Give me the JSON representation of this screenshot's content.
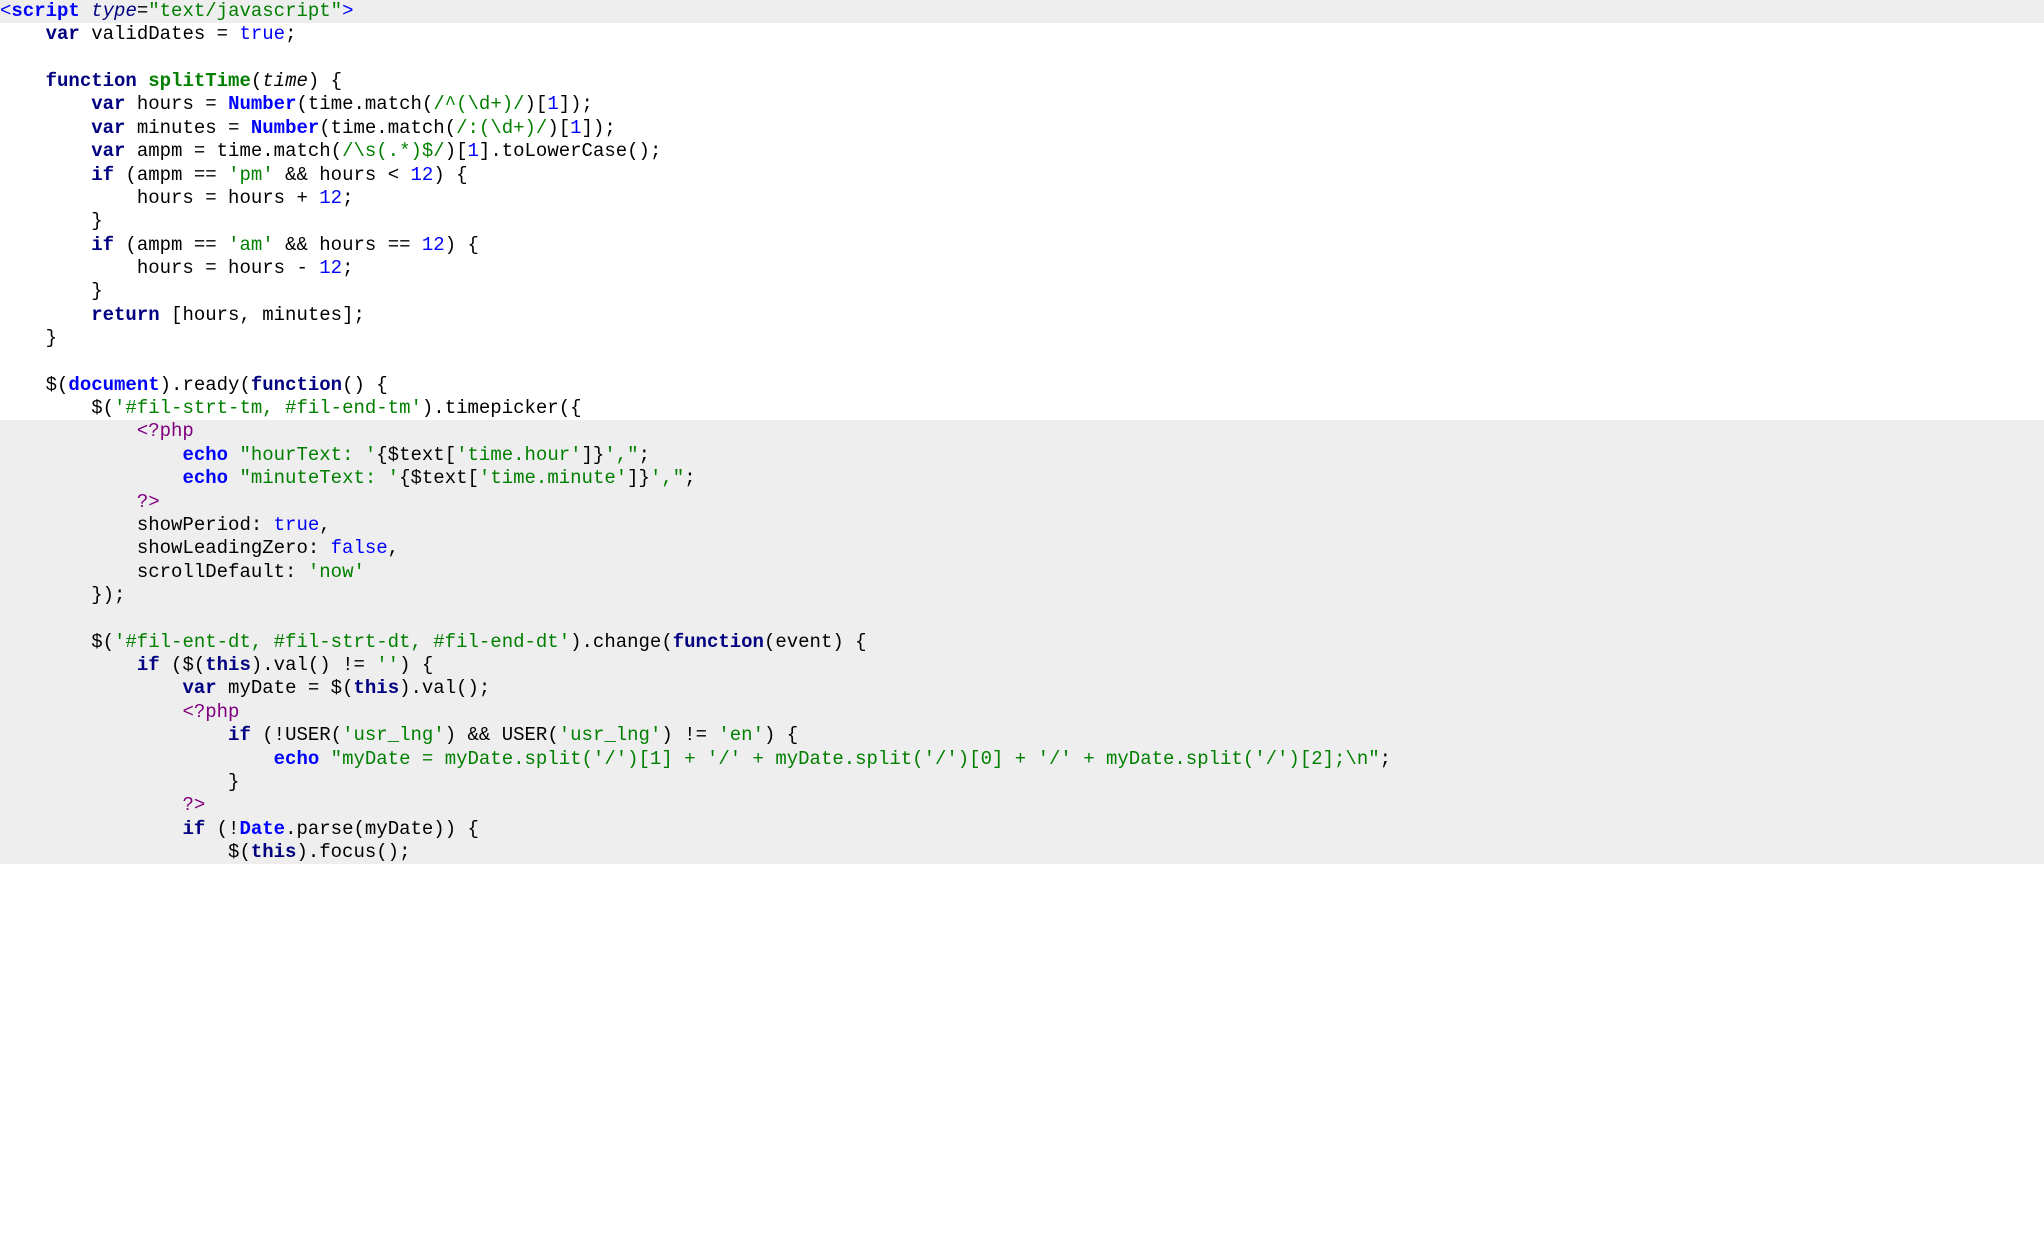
{
  "lines": [
    {
      "hl": true,
      "indent": 0,
      "html": "<span class='tag'>&lt;<b>script</b></span> <span class='attr'>type</span>=<span class='str'>\"text/javascript\"</span><span class='tag'>&gt;</span>"
    },
    {
      "hl": false,
      "indent": 4,
      "html": "<span class='kw'>var</span> validDates = <span class='bool'>true</span>;"
    },
    {
      "hl": false,
      "indent": 0,
      "html": ""
    },
    {
      "hl": false,
      "indent": 4,
      "html": "<span class='kw'>function</span> <span class='fnname'>splitTime</span>(<span class='param'>time</span>)<span class='op'> {</span>"
    },
    {
      "hl": false,
      "indent": 8,
      "html": "<span class='kw'>var</span> hours = <span class='global'>Number</span>(time.match(<span class='regex'>/^(\\d+)/</span>)[<span class='num'>1</span>]);"
    },
    {
      "hl": false,
      "indent": 8,
      "html": "<span class='kw'>var</span> minutes = <span class='global'>Number</span>(time.match(<span class='regex'>/:(\\d+)/</span>)[<span class='num'>1</span>]);"
    },
    {
      "hl": false,
      "indent": 8,
      "html": "<span class='kw'>var</span> ampm = time.match(<span class='regex'>/\\s(.*)$/</span>)[<span class='num'>1</span>].toLowerCase();"
    },
    {
      "hl": false,
      "indent": 8,
      "html": "<span class='kw'>if</span> (ampm == <span class='str'>'pm'</span> &amp;&amp; hours &lt; <span class='num'>12</span>) {"
    },
    {
      "hl": false,
      "indent": 12,
      "html": "hours = hours + <span class='num'>12</span>;"
    },
    {
      "hl": false,
      "indent": 8,
      "html": "}"
    },
    {
      "hl": false,
      "indent": 8,
      "html": "<span class='kw'>if</span> (ampm == <span class='str'>'am'</span> &amp;&amp; hours == <span class='num'>12</span>) {"
    },
    {
      "hl": false,
      "indent": 12,
      "html": "hours = hours - <span class='num'>12</span>;"
    },
    {
      "hl": false,
      "indent": 8,
      "html": "}"
    },
    {
      "hl": false,
      "indent": 8,
      "html": "<span class='kw'>return</span> [hours, minutes];"
    },
    {
      "hl": false,
      "indent": 4,
      "html": "}"
    },
    {
      "hl": false,
      "indent": 0,
      "html": ""
    },
    {
      "hl": false,
      "indent": 4,
      "html": "$(<span class='global'>document</span>).ready(<span class='fn'>function</span>() {"
    },
    {
      "hl": false,
      "indent": 8,
      "html": "$(<span class='str'>'#fil-strt-tm, #fil-end-tm'</span>).timepicker({"
    },
    {
      "hl": true,
      "indent": 12,
      "html": "<span class='phptag'>&lt;?php</span>"
    },
    {
      "hl": true,
      "indent": 16,
      "html": "<span class='phpkw'>echo</span> <span class='phpstr'>\"hourText: '</span>{$text[<span class='phpstr'>'time.hour'</span>]}<span class='phpstr'>',\"</span>;"
    },
    {
      "hl": true,
      "indent": 16,
      "html": "<span class='phpkw'>echo</span> <span class='phpstr'>\"minuteText: '</span>{$text[<span class='phpstr'>'time.minute'</span>]}<span class='phpstr'>',\"</span>;"
    },
    {
      "hl": true,
      "indent": 12,
      "html": "<span class='phptag'>?&gt;</span>"
    },
    {
      "hl": true,
      "indent": 12,
      "html": "showPeriod: <span class='bool'>true</span>,"
    },
    {
      "hl": true,
      "indent": 12,
      "html": "showLeadingZero: <span class='bool'>false</span>,"
    },
    {
      "hl": true,
      "indent": 12,
      "html": "scrollDefault: <span class='str'>'now'</span>"
    },
    {
      "hl": true,
      "indent": 8,
      "html": "});"
    },
    {
      "hl": true,
      "indent": 0,
      "html": ""
    },
    {
      "hl": true,
      "indent": 8,
      "html": "$(<span class='str'>'#fil-ent-dt, #fil-strt-dt, #fil-end-dt'</span>).change(<span class='fn'>function</span>(event) {"
    },
    {
      "hl": true,
      "indent": 12,
      "html": "<span class='kw'>if</span> ($(<span class='kw'>this</span>).val() != <span class='str'>''</span>) {"
    },
    {
      "hl": true,
      "indent": 16,
      "html": "<span class='kw'>var</span> myDate = $(<span class='kw'>this</span>).val();"
    },
    {
      "hl": true,
      "indent": 16,
      "html": "<span class='phptag'>&lt;?php</span>"
    },
    {
      "hl": true,
      "indent": 20,
      "html": "<span class='kw'>if</span> (!USER(<span class='phpstr'>'usr_lng'</span>) &amp;&amp; USER(<span class='phpstr'>'usr_lng'</span>) != <span class='phpstr'>'en'</span>) {"
    },
    {
      "hl": true,
      "indent": 24,
      "html": "<span class='phpkw'>echo</span> <span class='phpstr'>\"myDate = myDate.split('/')[1] + '/' + myDate.split('/')[0] + '/' + myDate.split('/')[2];\\n\"</span>;"
    },
    {
      "hl": true,
      "indent": 20,
      "html": "}"
    },
    {
      "hl": true,
      "indent": 16,
      "html": "<span class='phptag'>?&gt;</span>"
    },
    {
      "hl": true,
      "indent": 16,
      "html": "<span class='kw'>if</span> (!<span class='global'>Date</span>.parse(myDate)) {"
    },
    {
      "hl": true,
      "indent": 20,
      "html": "$(<span class='kw'>this</span>).focus();"
    }
  ]
}
